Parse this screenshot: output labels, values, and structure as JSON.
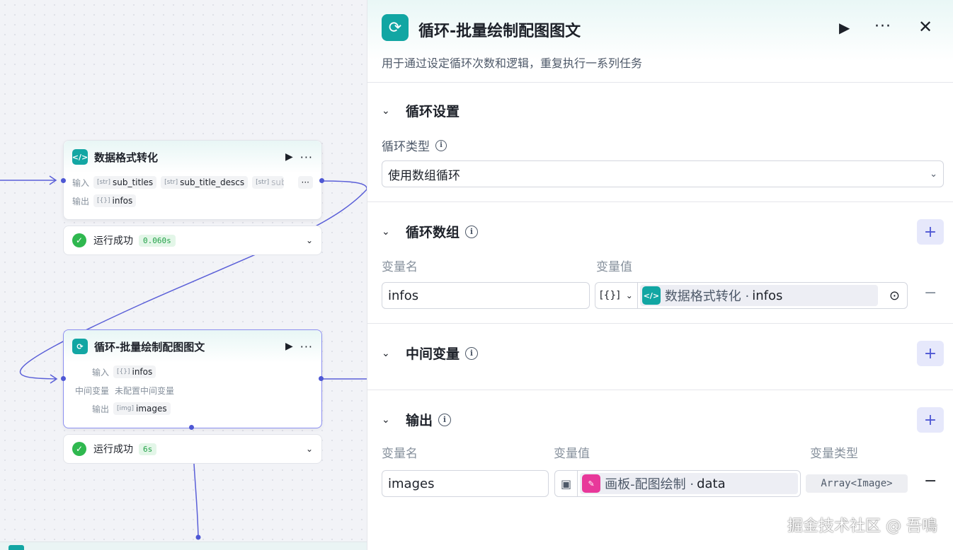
{
  "canvas": {
    "node1": {
      "title": "数据格式转化",
      "icon": "code-icon",
      "input_label": "输入",
      "inputs": [
        {
          "type": "[str]",
          "name": "sub_titles"
        },
        {
          "type": "[str]",
          "name": "sub_title_descs"
        },
        {
          "type": "[str]",
          "name": "sub_"
        }
      ],
      "more": "···",
      "output_label": "输出",
      "output": {
        "type": "[{}]",
        "name": "infos"
      }
    },
    "node1_status": {
      "text": "运行成功",
      "time": "0.060s"
    },
    "node2": {
      "title": "循环-批量绘制配图图文",
      "icon": "loop-icon",
      "input_label": "输入",
      "input": {
        "type": "[{}]",
        "name": "infos"
      },
      "mid_label": "中间变量",
      "mid_value": "未配置中间变量",
      "output_label": "输出",
      "output": {
        "type": "[img]",
        "name": "images"
      }
    },
    "node2_status": {
      "text": "运行成功",
      "time": "6s"
    }
  },
  "panel": {
    "title": "循环-批量绘制配图图文",
    "description": "用于通过设定循环次数和逻辑，重复执行一系列任务",
    "loop_settings": {
      "title": "循环设置",
      "type_label": "循环类型",
      "type_value": "使用数组循环"
    },
    "loop_array": {
      "title": "循环数组",
      "col_name": "变量名",
      "col_value": "变量值",
      "row": {
        "name": "infos",
        "type": "[{}]",
        "ref_node": "数据格式转化 · ",
        "ref_var": "infos"
      }
    },
    "intermediate": {
      "title": "中间变量"
    },
    "output": {
      "title": "输出",
      "col_name": "变量名",
      "col_value": "变量值",
      "col_type": "变量类型",
      "row": {
        "name": "images",
        "ref_node": "画板-配图绘制 · ",
        "ref_var": "data",
        "type": "Array<Image>"
      }
    }
  },
  "watermark": "掘金技术社区 @ 吾鳴",
  "colors": {
    "accent": "#4e57d4",
    "teal": "#12a6a3",
    "success": "#2fb84f",
    "pink": "#e8389a"
  }
}
